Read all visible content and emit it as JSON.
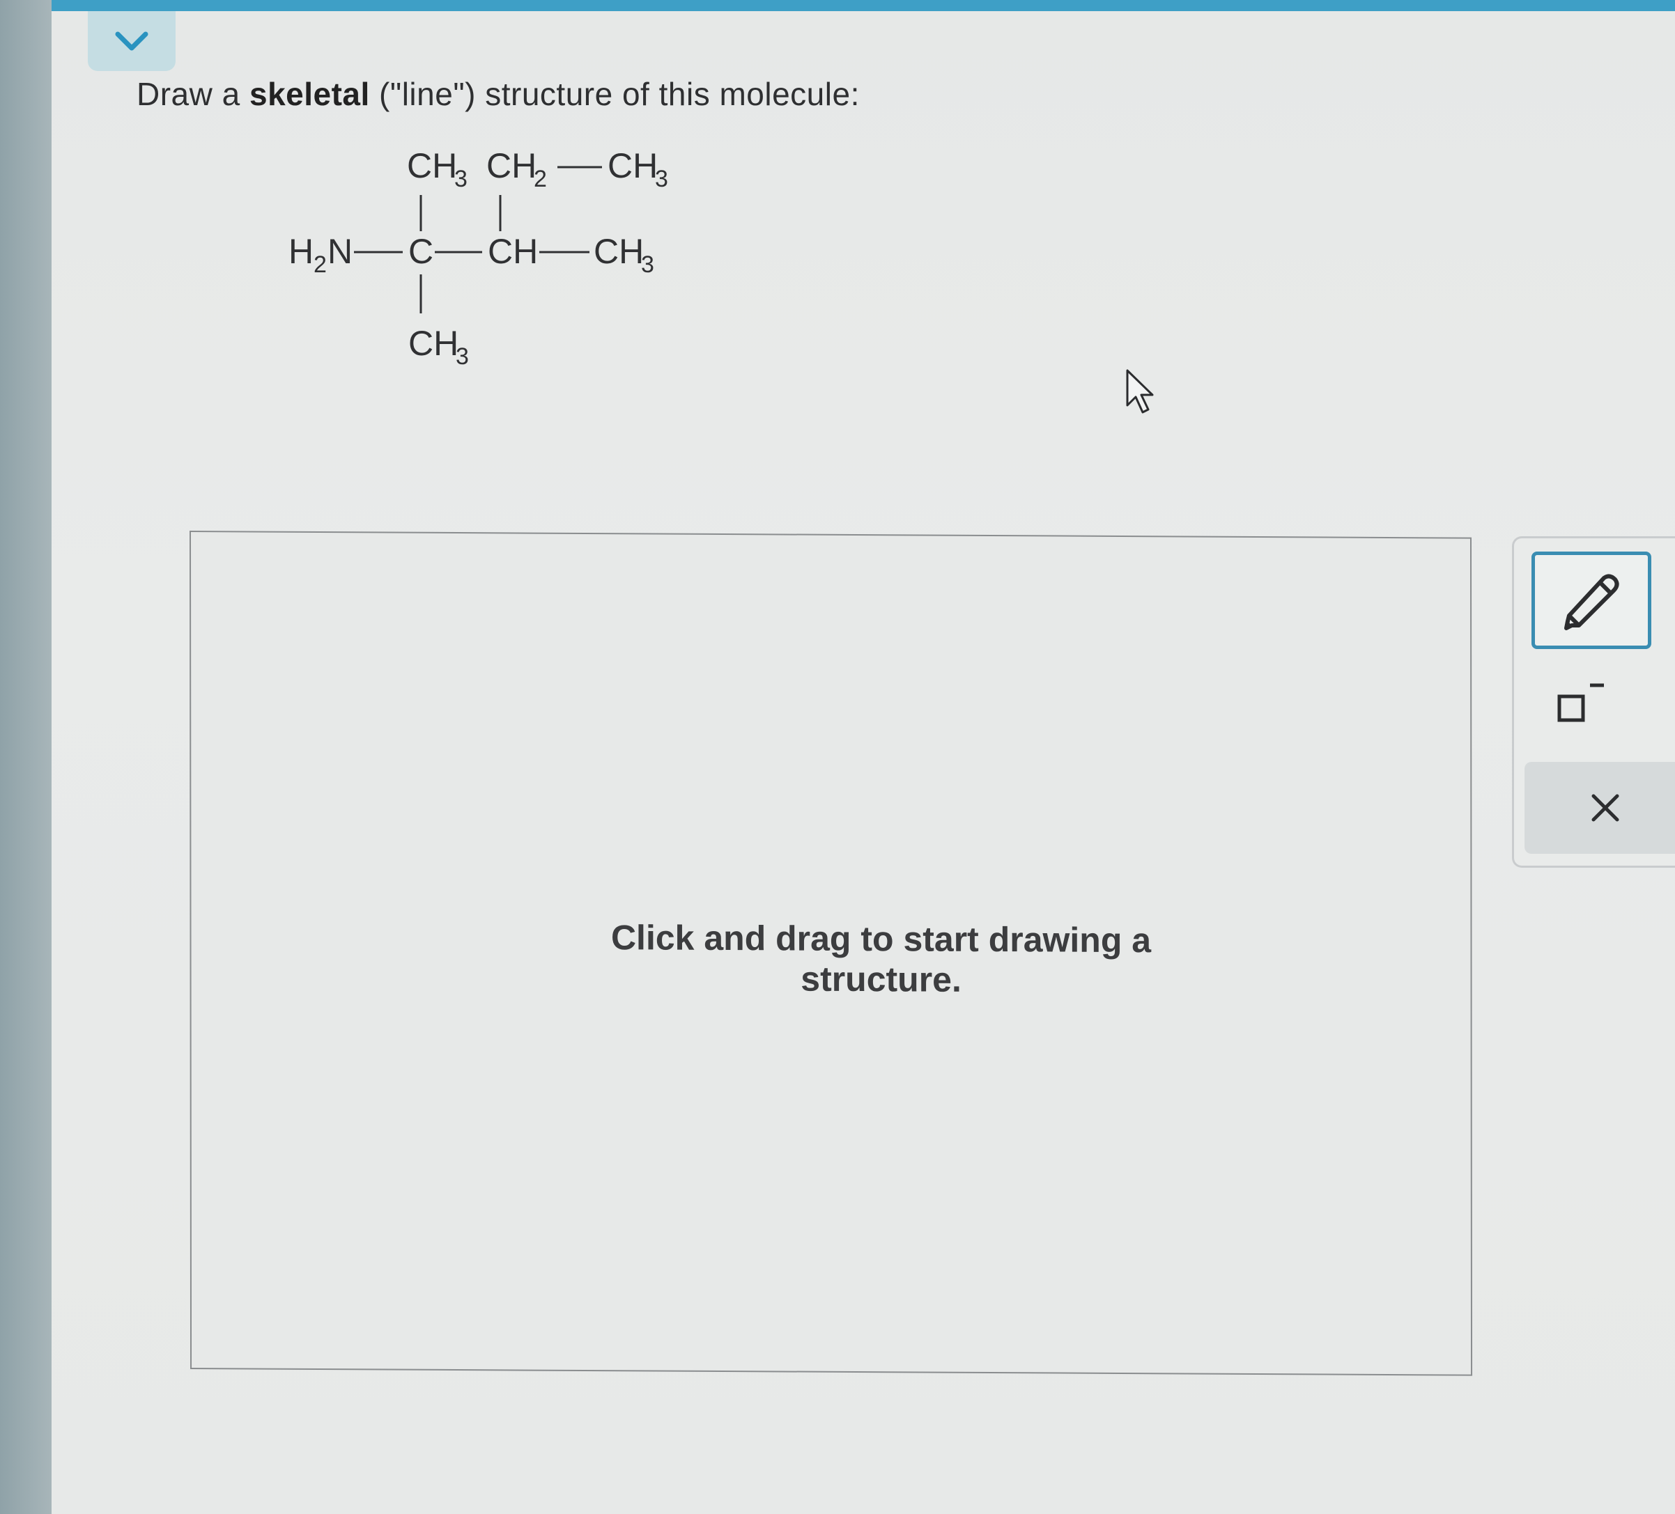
{
  "question": {
    "prefix": "Draw a ",
    "bold": "skeletal",
    "suffix": " (\"line\") structure of this molecule:"
  },
  "molecule": {
    "labels": {
      "top_ch3": "CH",
      "top_ch3_sub": "3",
      "top_ch2": "CH",
      "top_ch2_sub": "2",
      "top_right_ch3": "CH",
      "top_right_ch3_sub": "3",
      "h2n_h": "H",
      "h2n_sub": "2",
      "h2n_n": "N",
      "center_c": "C",
      "ch": "CH",
      "right_ch3": "CH",
      "right_ch3_sub": "3",
      "bottom_ch3": "CH",
      "bottom_ch3_sub": "3"
    }
  },
  "canvas": {
    "hint_line1": "Click and drag to start drawing a",
    "hint_line2": "structure."
  },
  "toolbar": {
    "pencil_icon": "pencil-icon",
    "charge_icon": "charge-box-icon",
    "clear_icon": "close-icon"
  },
  "colors": {
    "accent": "#3e9fc6",
    "tab": "#c5dde3",
    "pencil_border": "#3a8db2",
    "text": "#2e2f31"
  }
}
